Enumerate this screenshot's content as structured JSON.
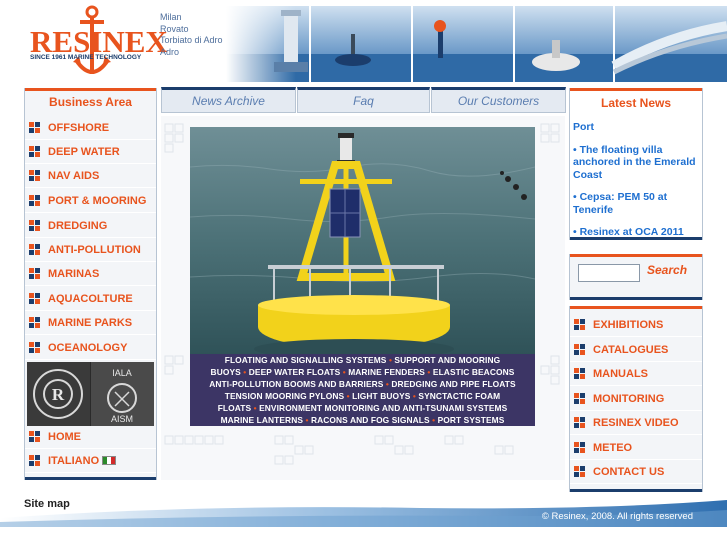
{
  "header": {
    "logo_text": "RESINEX",
    "logo_tagline": "SINCE 1961 MARINE TECHNOLOGY",
    "cities": [
      "Milan",
      "Rovato",
      "Torbiato di Adro",
      "Adro"
    ]
  },
  "left_panel": {
    "title": "Business Area",
    "items": [
      {
        "label": "OFFSHORE"
      },
      {
        "label": "DEEP WATER"
      },
      {
        "label": "NAV AIDS"
      },
      {
        "label": "PORT & MOORING"
      },
      {
        "label": "DREDGING"
      },
      {
        "label": "ANTI-POLLUTION"
      },
      {
        "label": "MARINAS"
      },
      {
        "label": "AQUACOLTURE"
      },
      {
        "label": "MARINE PARKS"
      },
      {
        "label": "OCEANOLOGY"
      }
    ],
    "badge_iala": [
      "IALA",
      "AISM"
    ],
    "home_label": "HOME",
    "language_label": "ITALIANO"
  },
  "tabs": [
    {
      "label": "News Archive"
    },
    {
      "label": "Faq"
    },
    {
      "label": "Our Customers"
    }
  ],
  "caption": [
    [
      "FLOATING AND SIGNALLING SYSTEMS",
      "SUPPORT AND MOORING"
    ],
    [
      "BUOYS",
      "DEEP WATER FLOATS",
      "MARINE FENDERS",
      "ELASTIC BEACONS"
    ],
    [
      "ANTI-POLLUTION BOOMS AND BARRIERS",
      "DREDGING AND PIPE FLOATS"
    ],
    [
      "TENSION MOORING PYLONS",
      "LIGHT BUOYS",
      "SYNCTACTIC FOAM"
    ],
    [
      "FLOATS",
      "ENVIRONMENT MONITORING AND ANTI-TSUNAMI SYSTEMS"
    ],
    [
      "MARINE LANTERNS",
      "RACONS AND FOG SIGNALS",
      "PORT SYSTEMS"
    ]
  ],
  "news": {
    "title": "Latest News",
    "items": [
      {
        "text": "Port"
      },
      {
        "text": "•  The floating villa anchored in the Emerald Coast"
      },
      {
        "text": "•  Cepsa: PEM 50 at Tenerife"
      },
      {
        "text": "•  Resinex at OCA 2011"
      }
    ]
  },
  "search": {
    "placeholder": "",
    "button_label": "Search"
  },
  "right_links": [
    {
      "label": "EXHIBITIONS"
    },
    {
      "label": "CATALOGUES"
    },
    {
      "label": "MANUALS"
    },
    {
      "label": "MONITORING"
    },
    {
      "label": "RESINEX VIDEO"
    },
    {
      "label": "METEO"
    },
    {
      "label": "CONTACT US"
    }
  ],
  "footer": {
    "sitemap_label": "Site map",
    "copyright": "© Resinex, 2008.  All rights reserved"
  },
  "colors": {
    "accent_orange": "#e8541e",
    "navy": "#1b3d6c",
    "link_blue": "#1e6fd0",
    "caption_bg": "#3c3565",
    "buoy_yellow": "#f2d21b"
  }
}
